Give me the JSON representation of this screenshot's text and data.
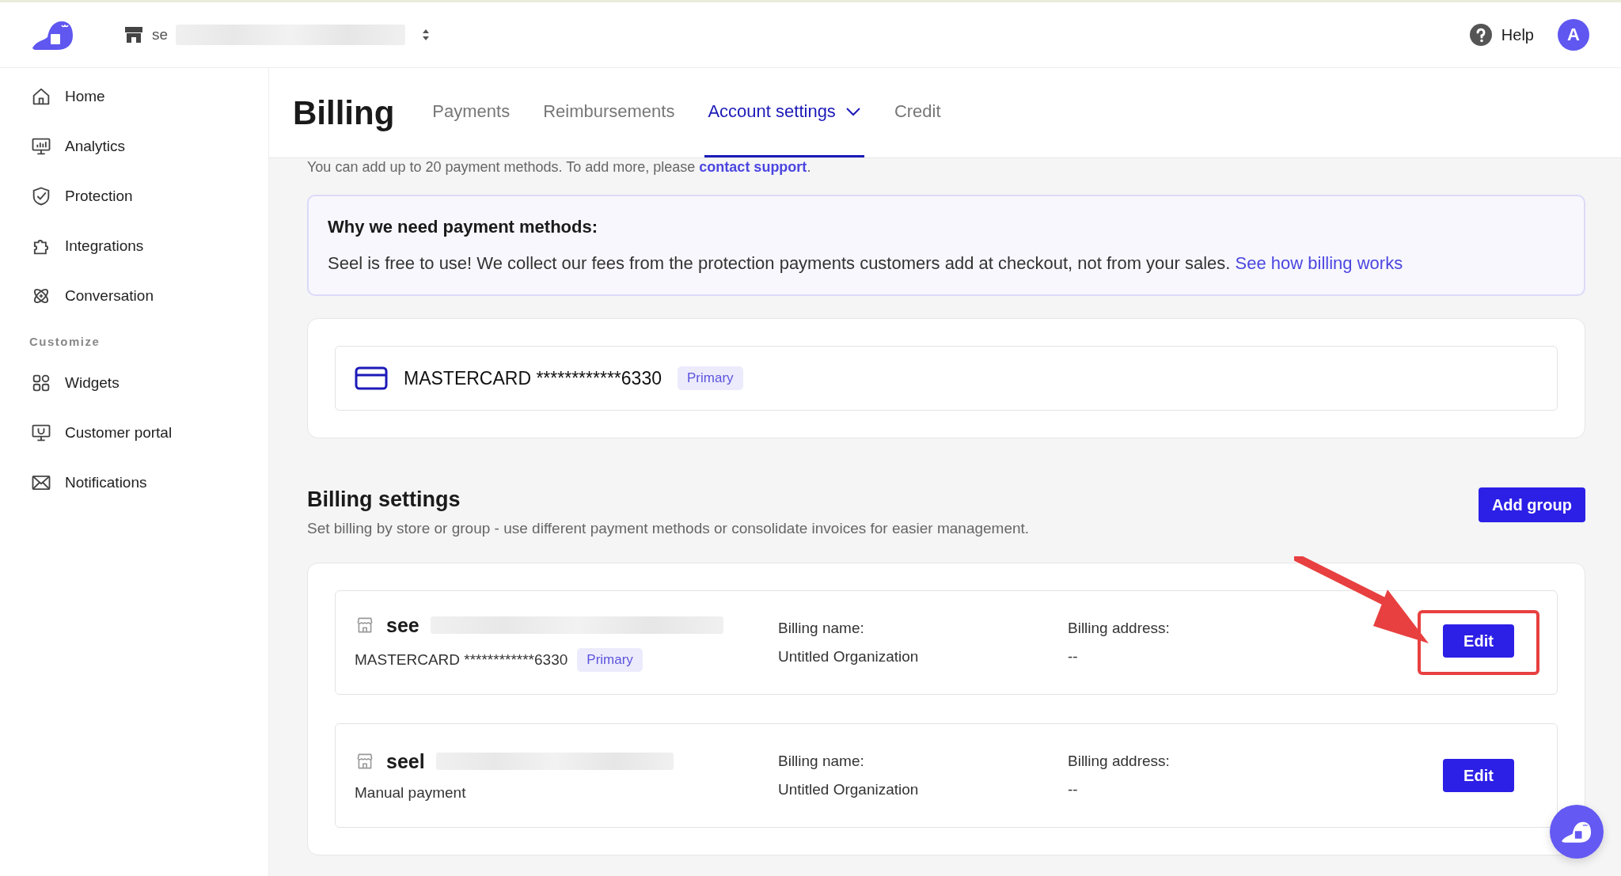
{
  "header": {
    "store_selector": {
      "label": "se"
    },
    "help": "Help",
    "avatar": "A"
  },
  "sidebar": {
    "items": [
      {
        "label": "Home"
      },
      {
        "label": "Analytics"
      },
      {
        "label": "Protection"
      },
      {
        "label": "Integrations"
      },
      {
        "label": "Conversation"
      }
    ],
    "section": "Customize",
    "section_items": [
      {
        "label": "Widgets"
      },
      {
        "label": "Customer portal"
      },
      {
        "label": "Notifications"
      }
    ]
  },
  "page": {
    "title": "Billing",
    "tabs": [
      {
        "label": "Payments",
        "selected": false,
        "kind": "link"
      },
      {
        "label": "Reimbursements",
        "selected": false,
        "kind": "link"
      },
      {
        "label": "Account settings",
        "selected": true,
        "kind": "dropdown"
      },
      {
        "label": "Credit",
        "selected": false,
        "kind": "link"
      }
    ]
  },
  "limit_note": {
    "text": "You can add up to 20 payment methods. To add more, please",
    "link": "contact support",
    "end": "."
  },
  "info_box": {
    "title": "Why we need payment methods:",
    "text": "Seel is free to use! We collect our fees from the protection payments customers add at checkout, not from your sales.",
    "link": "See how billing works"
  },
  "payment_methods": [
    {
      "label": "MASTERCARD ************6330",
      "badge": "Primary"
    }
  ],
  "billing_settings": {
    "title": "Billing settings",
    "description": "Set billing by store or group - use different payment methods or consolidate invoices for easier management.",
    "add_button": "Add group",
    "groups": [
      {
        "name": "see",
        "payment": "MASTERCARD ************6330",
        "badge": "Primary",
        "name_label": "Billing name:",
        "name_value": "Untitled Organization",
        "address_label": "Billing address:",
        "address_value": "--",
        "button": "Edit",
        "highlighted": true
      },
      {
        "name": "seel",
        "payment": "Manual payment",
        "name_label": "Billing name:",
        "name_value": "Untitled Organization",
        "address_label": "Billing address:",
        "address_value": "--",
        "button": "Edit",
        "highlighted": false
      }
    ]
  }
}
